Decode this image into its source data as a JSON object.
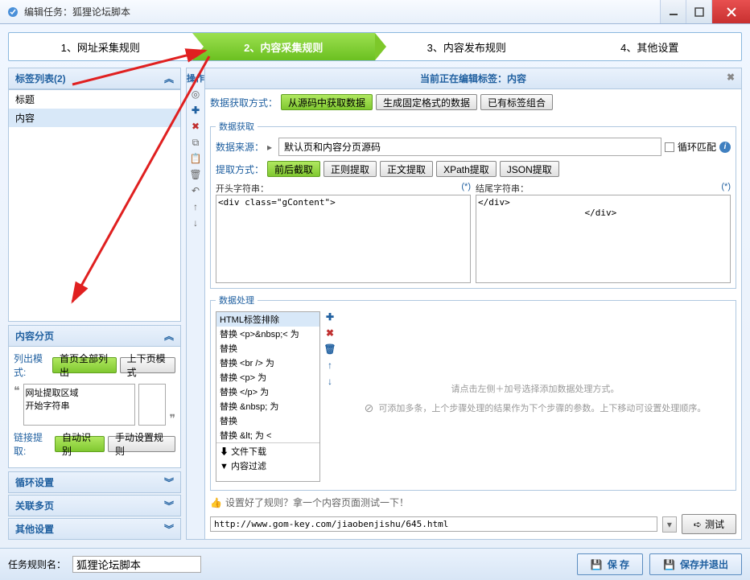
{
  "window": {
    "title": "编辑任务：狐狸论坛脚本"
  },
  "steps": {
    "s1": "1、网址采集规则",
    "s2": "2、内容采集规则",
    "s3": "3、内容发布规则",
    "s4": "4、其他设置"
  },
  "tag_panel": {
    "title": "标签列表(2)",
    "toolbar_title": "操作",
    "items": [
      "标题",
      "内容"
    ]
  },
  "pagination": {
    "title": "内容分页",
    "list_mode_label": "列出模式:",
    "btn_all": "首页全部列出",
    "btn_updown": "上下页模式",
    "extract_area": "网址提取区域\n开始字符串",
    "link_extract_label": "链接提取:",
    "btn_auto": "自动识别",
    "btn_manual": "手动设置规则"
  },
  "accordion": {
    "loop": "循环设置",
    "related": "关联多页",
    "other": "其他设置"
  },
  "editor": {
    "header": "当前正在编辑标签：内容",
    "method_label": "数据获取方式：",
    "method_btn1": "从源码中获取数据",
    "method_btn2": "生成固定格式的数据",
    "method_btn3": "已有标签组合",
    "extract_legend": "数据获取",
    "source_label": "数据来源：",
    "source_value": "默认页和内容分页源码",
    "loop_match": "循环匹配",
    "extract_method_label": "提取方式：",
    "em1": "前后截取",
    "em2": "正则提取",
    "em3": "正文提取",
    "em4": "XPath提取",
    "em5": "JSON提取",
    "start_label": "开头字符串：",
    "end_label": "结尾字符串：",
    "start_value": "<div class=\"gContent\">",
    "end_value": "</div>\n                    </div>",
    "process_legend": "数据处理",
    "proc_items": [
      "HTML标签排除",
      "替换 <p>&nbsp;< 为",
      "替换",
      "替换 <br /> 为",
      "替换 <p> 为",
      "替换 </p> 为",
      "替换 &nbsp; 为",
      "替换",
      "替换 &lt; 为 <"
    ],
    "proc_footer1": "文件下载",
    "proc_footer2": "内容过滤",
    "proc_hint1": "请点击左侧＋加号选择添加数据处理方式。",
    "proc_hint2": "可添加多条，上个步骤处理的结果作为下个步骤的参数。上下移动可设置处理顺序。",
    "test_hint": "设置好了规则？拿一个内容页面测试一下！",
    "test_url": "http://www.gom-key.com/jiaobenjishu/645.html",
    "btn_test": "测试"
  },
  "footer": {
    "rule_name_label": "任务规则名：",
    "rule_name": "狐狸论坛脚本",
    "btn_save": "保 存",
    "btn_save_exit": "保存并退出"
  }
}
